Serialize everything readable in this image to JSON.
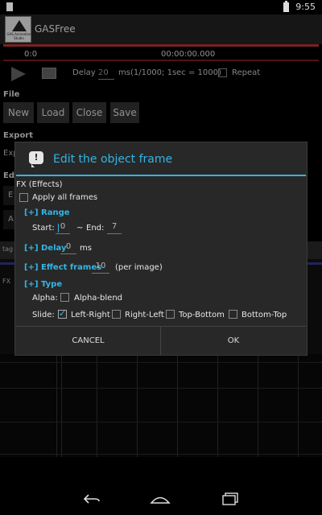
{
  "status_bar": {
    "time": "9:55"
  },
  "app": {
    "title": "GASFree",
    "icon_caption": "GAS Animation Studio"
  },
  "timeline": {
    "position": "0:0",
    "time": "00:00:00.000"
  },
  "controls": {
    "delay_label": "Delay",
    "delay_value": "20",
    "delay_unit": "ms(1/1000; 1sec = 1000)",
    "repeat_label": "Repeat"
  },
  "file_section": {
    "title": "File",
    "buttons": [
      "New",
      "Load",
      "Close",
      "Save"
    ]
  },
  "export_section": {
    "title": "Export",
    "partial": "Exp"
  },
  "edit_section": {
    "partial": "Ed",
    "row1": "E",
    "row2": "A"
  },
  "track": {
    "tag": "tag",
    "fx": "FX"
  },
  "dialog": {
    "title": "Edit the object frame",
    "fx_label": "FX (Effects)",
    "apply_all_label": "Apply all frames",
    "apply_all_checked": false,
    "range": {
      "header": "[+] Range",
      "start_label": "Start:",
      "start_value": "0",
      "tilde": "~",
      "end_label": "End:",
      "end_value": "7"
    },
    "delay": {
      "header": "[+] Delay",
      "value": "0",
      "unit": "ms"
    },
    "effect_frames": {
      "header": "[+] Effect frames",
      "value": "10",
      "unit": "(per image)"
    },
    "type": {
      "header": "[+] Type",
      "alpha_label": "Alpha:",
      "alpha_option": "Alpha-blend",
      "alpha_checked": false,
      "slide_label": "Slide:",
      "slide_options": [
        {
          "label": "Left-Right",
          "checked": true
        },
        {
          "label": "Right-Left",
          "checked": false
        },
        {
          "label": "Top-Bottom",
          "checked": false
        },
        {
          "label": "Bottom-Top",
          "checked": false
        }
      ]
    },
    "cancel_label": "CANCEL",
    "ok_label": "OK"
  },
  "colors": {
    "accent": "#33b5e5",
    "timeline_red": "#b33333"
  }
}
